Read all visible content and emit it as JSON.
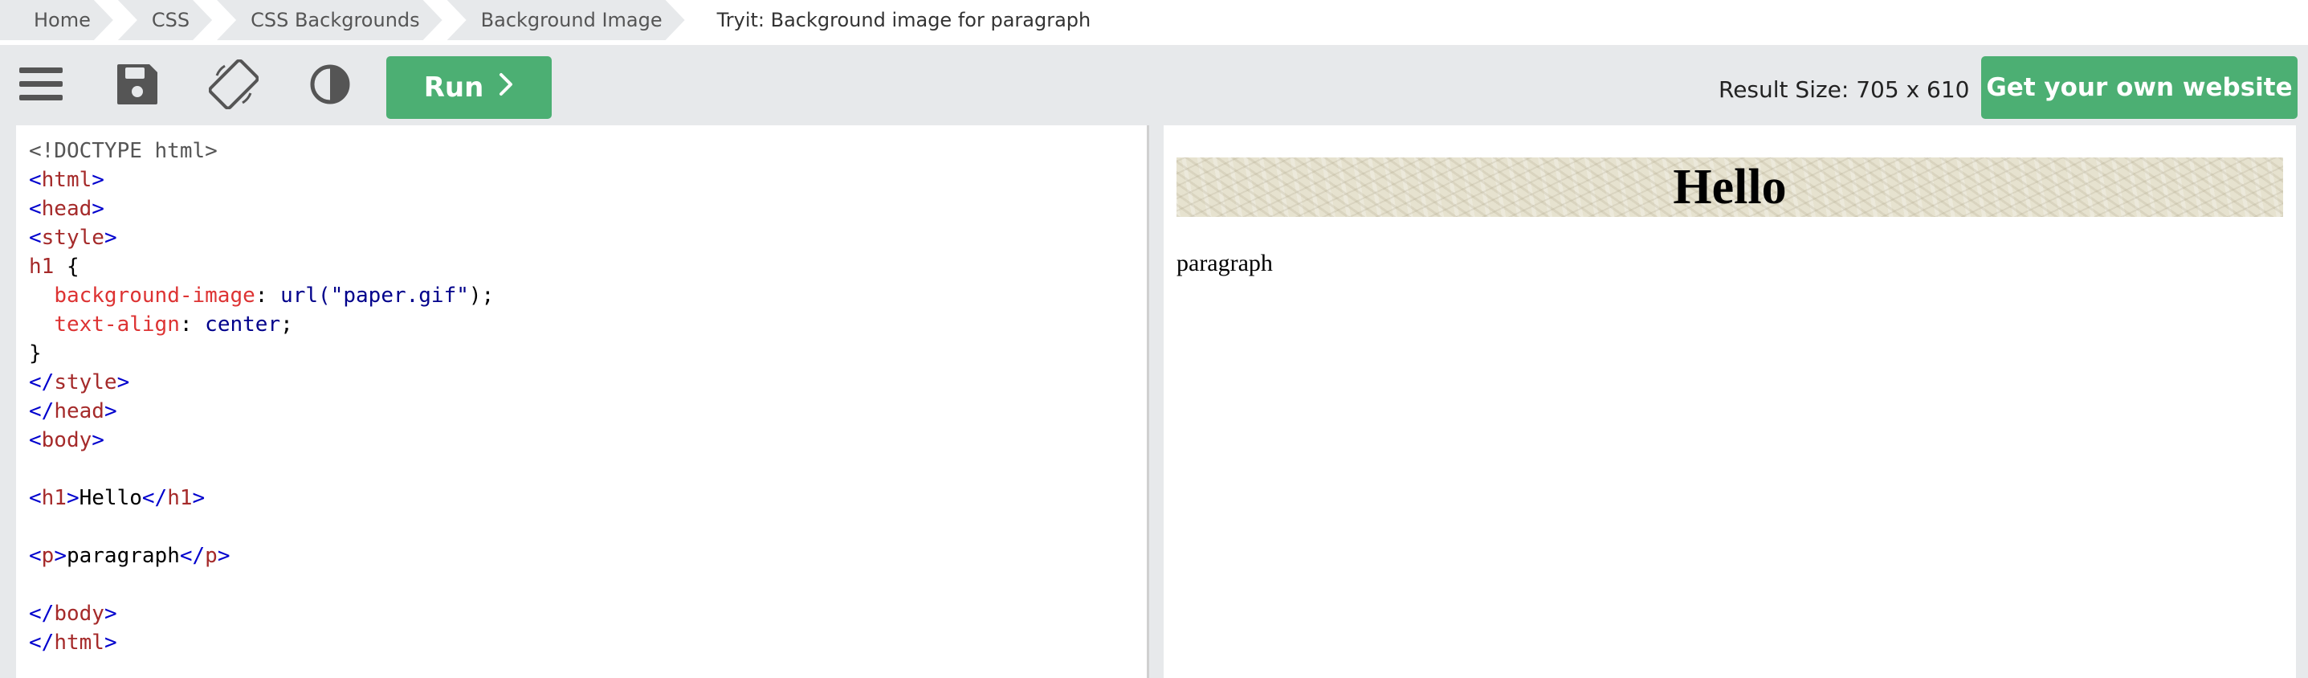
{
  "breadcrumb": {
    "items": [
      "Home",
      "CSS",
      "CSS Backgrounds",
      "Background Image"
    ],
    "current": "Tryit: Background image for paragraph"
  },
  "toolbar": {
    "menu_icon": "hamburger-menu-icon",
    "save_icon": "save-icon",
    "rotate_icon": "rotate-orientation-icon",
    "theme_icon": "contrast-theme-icon",
    "run_label": "Run",
    "run_icon": "chevron-right-icon",
    "result_size": "Result Size: 705 x 610",
    "own_website_label": "Get your own website",
    "accent_color": "#4caf73"
  },
  "editor": {
    "lines": [
      [
        {
          "t": "<!DOCTYPE html>",
          "c": "doc"
        }
      ],
      [
        {
          "t": "<",
          "c": "brk"
        },
        {
          "t": "html",
          "c": "tag"
        },
        {
          "t": ">",
          "c": "brk"
        }
      ],
      [
        {
          "t": "<",
          "c": "brk"
        },
        {
          "t": "head",
          "c": "tag"
        },
        {
          "t": ">",
          "c": "brk"
        }
      ],
      [
        {
          "t": "<",
          "c": "brk"
        },
        {
          "t": "style",
          "c": "tag"
        },
        {
          "t": ">",
          "c": "brk"
        }
      ],
      [
        {
          "t": "h1",
          "c": "sel"
        },
        {
          "t": " {",
          "c": "txt"
        }
      ],
      [
        {
          "t": "  ",
          "c": "txt"
        },
        {
          "t": "background-image",
          "c": "prop"
        },
        {
          "t": ": ",
          "c": "txt"
        },
        {
          "t": "url(",
          "c": "val"
        },
        {
          "t": "\"paper.gif\"",
          "c": "str"
        },
        {
          "t": ");",
          "c": "txt"
        }
      ],
      [
        {
          "t": "  ",
          "c": "txt"
        },
        {
          "t": "text-align",
          "c": "prop"
        },
        {
          "t": ": ",
          "c": "txt"
        },
        {
          "t": "center",
          "c": "val"
        },
        {
          "t": ";",
          "c": "txt"
        }
      ],
      [
        {
          "t": "}",
          "c": "txt"
        }
      ],
      [
        {
          "t": "</",
          "c": "brk"
        },
        {
          "t": "style",
          "c": "tag"
        },
        {
          "t": ">",
          "c": "brk"
        }
      ],
      [
        {
          "t": "</",
          "c": "brk"
        },
        {
          "t": "head",
          "c": "tag"
        },
        {
          "t": ">",
          "c": "brk"
        }
      ],
      [
        {
          "t": "<",
          "c": "brk"
        },
        {
          "t": "body",
          "c": "tag"
        },
        {
          "t": ">",
          "c": "brk"
        }
      ],
      [],
      [
        {
          "t": "<",
          "c": "brk"
        },
        {
          "t": "h1",
          "c": "tag"
        },
        {
          "t": ">",
          "c": "brk"
        },
        {
          "t": "Hello",
          "c": "txt"
        },
        {
          "t": "</",
          "c": "brk"
        },
        {
          "t": "h1",
          "c": "tag"
        },
        {
          "t": ">",
          "c": "brk"
        }
      ],
      [],
      [
        {
          "t": "<",
          "c": "brk"
        },
        {
          "t": "p",
          "c": "tag"
        },
        {
          "t": ">",
          "c": "brk"
        },
        {
          "t": "paragraph",
          "c": "txt"
        },
        {
          "t": "</",
          "c": "brk"
        },
        {
          "t": "p",
          "c": "tag"
        },
        {
          "t": ">",
          "c": "brk"
        }
      ],
      [],
      [
        {
          "t": "</",
          "c": "brk"
        },
        {
          "t": "body",
          "c": "tag"
        },
        {
          "t": ">",
          "c": "brk"
        }
      ],
      [
        {
          "t": "</",
          "c": "brk"
        },
        {
          "t": "html",
          "c": "tag"
        },
        {
          "t": ">",
          "c": "brk"
        }
      ]
    ]
  },
  "result": {
    "heading": "Hello",
    "paragraph": "paragraph"
  }
}
